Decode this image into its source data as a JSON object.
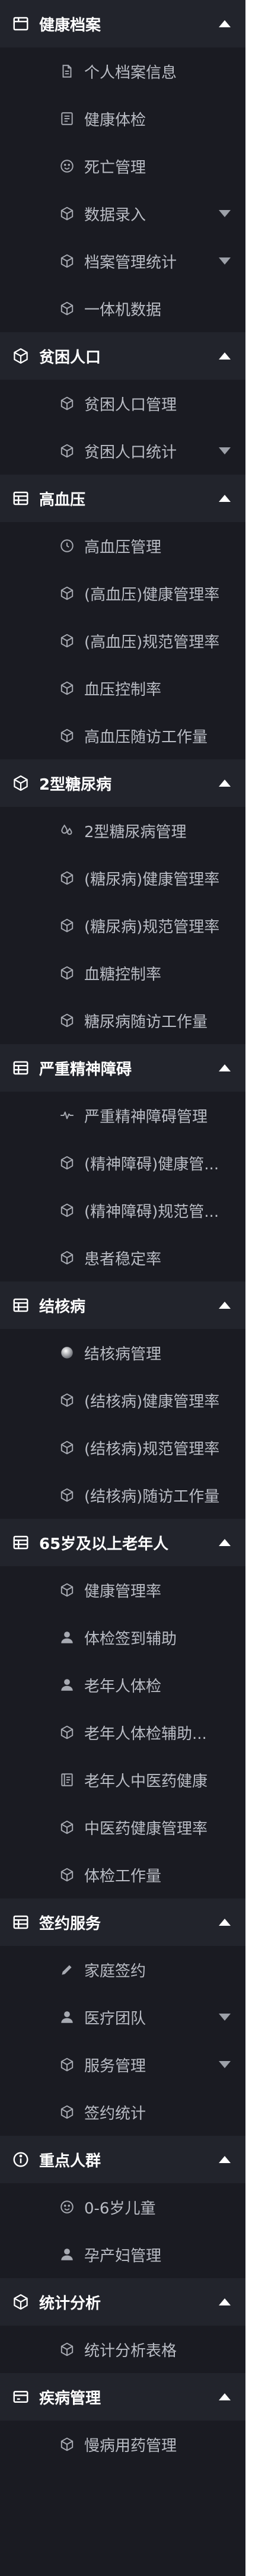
{
  "sections": [
    {
      "title": "健康档案",
      "icon": "folder-icon",
      "expanded": true,
      "items": [
        {
          "label": "个人档案信息",
          "icon": "document-icon"
        },
        {
          "label": "健康体检",
          "icon": "list-box-icon"
        },
        {
          "label": "死亡管理",
          "icon": "face-icon"
        },
        {
          "label": "数据录入",
          "icon": "cube-icon",
          "dropdown": true
        },
        {
          "label": "档案管理统计",
          "icon": "cube-icon",
          "dropdown": true
        },
        {
          "label": "一体机数据",
          "icon": "cube-icon"
        }
      ]
    },
    {
      "title": "贫困人口",
      "icon": "cube-icon",
      "expanded": true,
      "items": [
        {
          "label": "贫困人口管理",
          "icon": "cube-icon"
        },
        {
          "label": "贫困人口统计",
          "icon": "cube-icon",
          "dropdown": true
        }
      ]
    },
    {
      "title": "高血压",
      "icon": "table-icon",
      "expanded": true,
      "items": [
        {
          "label": "高血压管理",
          "icon": "clock-icon"
        },
        {
          "label": "(高血压)健康管理率",
          "icon": "cube-icon"
        },
        {
          "label": "(高血压)规范管理率",
          "icon": "cube-icon"
        },
        {
          "label": "血压控制率",
          "icon": "cube-icon"
        },
        {
          "label": "高血压随访工作量",
          "icon": "cube-icon"
        }
      ]
    },
    {
      "title": "2型糖尿病",
      "icon": "cube-icon",
      "expanded": true,
      "items": [
        {
          "label": "2型糖尿病管理",
          "icon": "drops-icon"
        },
        {
          "label": "(糖尿病)健康管理率",
          "icon": "cube-icon"
        },
        {
          "label": "(糖尿病)规范管理率",
          "icon": "cube-icon"
        },
        {
          "label": "血糖控制率",
          "icon": "cube-icon"
        },
        {
          "label": "糖尿病随访工作量",
          "icon": "cube-icon"
        }
      ]
    },
    {
      "title": "严重精神障碍",
      "icon": "table-icon",
      "expanded": true,
      "items": [
        {
          "label": "严重精神障碍管理",
          "icon": "pulse-icon"
        },
        {
          "label": "(精神障碍)健康管...",
          "icon": "cube-icon"
        },
        {
          "label": "(精神障碍)规范管...",
          "icon": "cube-icon"
        },
        {
          "label": "患者稳定率",
          "icon": "cube-icon"
        }
      ]
    },
    {
      "title": "结核病",
      "icon": "table-icon",
      "expanded": true,
      "items": [
        {
          "label": "结核病管理",
          "icon": "sphere-icon"
        },
        {
          "label": "(结核病)健康管理率",
          "icon": "cube-icon"
        },
        {
          "label": "(结核病)规范管理率",
          "icon": "cube-icon"
        },
        {
          "label": "(结核病)随访工作量",
          "icon": "cube-icon"
        }
      ]
    },
    {
      "title": "65岁及以上老年人",
      "icon": "table-icon",
      "expanded": true,
      "items": [
        {
          "label": "健康管理率",
          "icon": "cube-icon"
        },
        {
          "label": "体检签到辅助",
          "icon": "person-icon"
        },
        {
          "label": "老年人体检",
          "icon": "person-icon"
        },
        {
          "label": "老年人体检辅助...",
          "icon": "cube-icon"
        },
        {
          "label": "老年人中医药健康",
          "icon": "book-icon"
        },
        {
          "label": "中医药健康管理率",
          "icon": "cube-icon"
        },
        {
          "label": "体检工作量",
          "icon": "cube-icon"
        }
      ]
    },
    {
      "title": "签约服务",
      "icon": "table-icon",
      "expanded": true,
      "items": [
        {
          "label": "家庭签约",
          "icon": "pencil-icon"
        },
        {
          "label": "医疗团队",
          "icon": "person-icon",
          "dropdown": true
        },
        {
          "label": "服务管理",
          "icon": "cube-icon",
          "dropdown": true
        },
        {
          "label": "签约统计",
          "icon": "cube-icon"
        }
      ]
    },
    {
      "title": "重点人群",
      "icon": "info-icon",
      "expanded": true,
      "items": [
        {
          "label": "0-6岁儿童",
          "icon": "face-icon"
        },
        {
          "label": "孕产妇管理",
          "icon": "person-icon"
        }
      ]
    },
    {
      "title": "统计分析",
      "icon": "cube-icon",
      "expanded": true,
      "items": [
        {
          "label": "统计分析表格",
          "icon": "cube-icon"
        }
      ]
    },
    {
      "title": "疾病管理",
      "icon": "card-icon",
      "expanded": true,
      "items": [
        {
          "label": "慢病用药管理",
          "icon": "cube-icon"
        }
      ]
    }
  ]
}
